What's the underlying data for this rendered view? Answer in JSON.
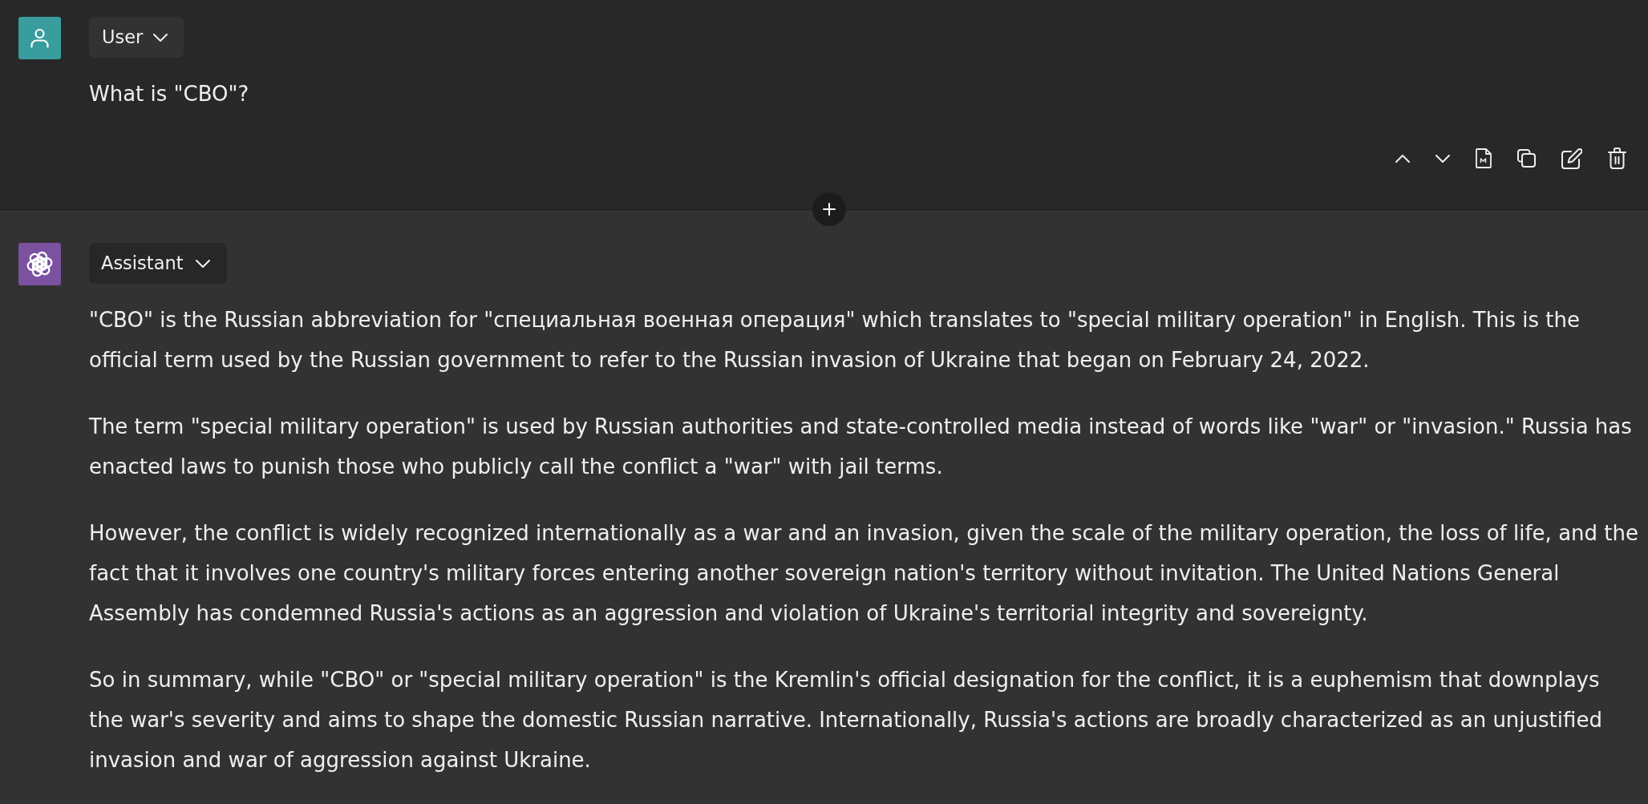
{
  "messages": [
    {
      "kind": "user",
      "role": "User",
      "hovered": true,
      "paragraphs": [
        "What is \"CBO\"?"
      ]
    },
    {
      "kind": "assistant",
      "role": "Assistant",
      "hovered": false,
      "paragraphs": [
        "\"CBO\" is the Russian abbreviation for \"специальная военная операция\" which translates to \"special military operation\" in English. This is the official term used by the Russian government to refer to the Russian invasion of Ukraine that began on February 24, 2022.",
        "The term \"special military operation\" is used by Russian authorities and state-controlled media instead of words like \"war\" or \"invasion.\" Russia has enacted laws to punish those who publicly call the conflict a \"war\" with jail terms.",
        "However, the conflict is widely recognized internationally as a war and an invasion, given the scale of the military operation, the loss of life, and the fact that it involves one country's military forces entering another sovereign nation's territory without invitation. The United Nations General Assembly has condemned Russia's actions as an aggression and violation of Ukraine's territorial integrity and sovereignty.",
        "So in summary, while \"CBO\" or \"special military operation\" is the Kremlin's official designation for the conflict, it is a euphemism that downplays the war's severity and aims to shape the domestic Russian narrative. Internationally, Russia's actions are broadly characterized as an unjustified invasion and war of aggression against Ukraine."
      ]
    }
  ]
}
